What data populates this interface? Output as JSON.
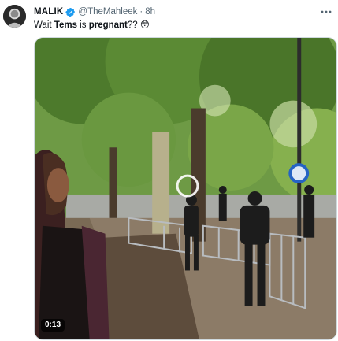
{
  "tweet": {
    "author_name": "MALIK",
    "handle": "@TheMahleek",
    "separator": "·",
    "time": "8h",
    "text_before": "Wait ",
    "text_bold": "Tems",
    "text_after": " is ",
    "text_bold2": "pregnant",
    "text_end": "?? 😳",
    "verified": true,
    "more_icon": "more-horizontal-icon"
  },
  "media": {
    "type": "video",
    "duration": "0:13",
    "play_icon": "play-icon",
    "description_kind": "outdoor park path scene"
  },
  "colors": {
    "text": "#0f1419",
    "secondary": "#536471",
    "verified": "#1d9bf0"
  }
}
